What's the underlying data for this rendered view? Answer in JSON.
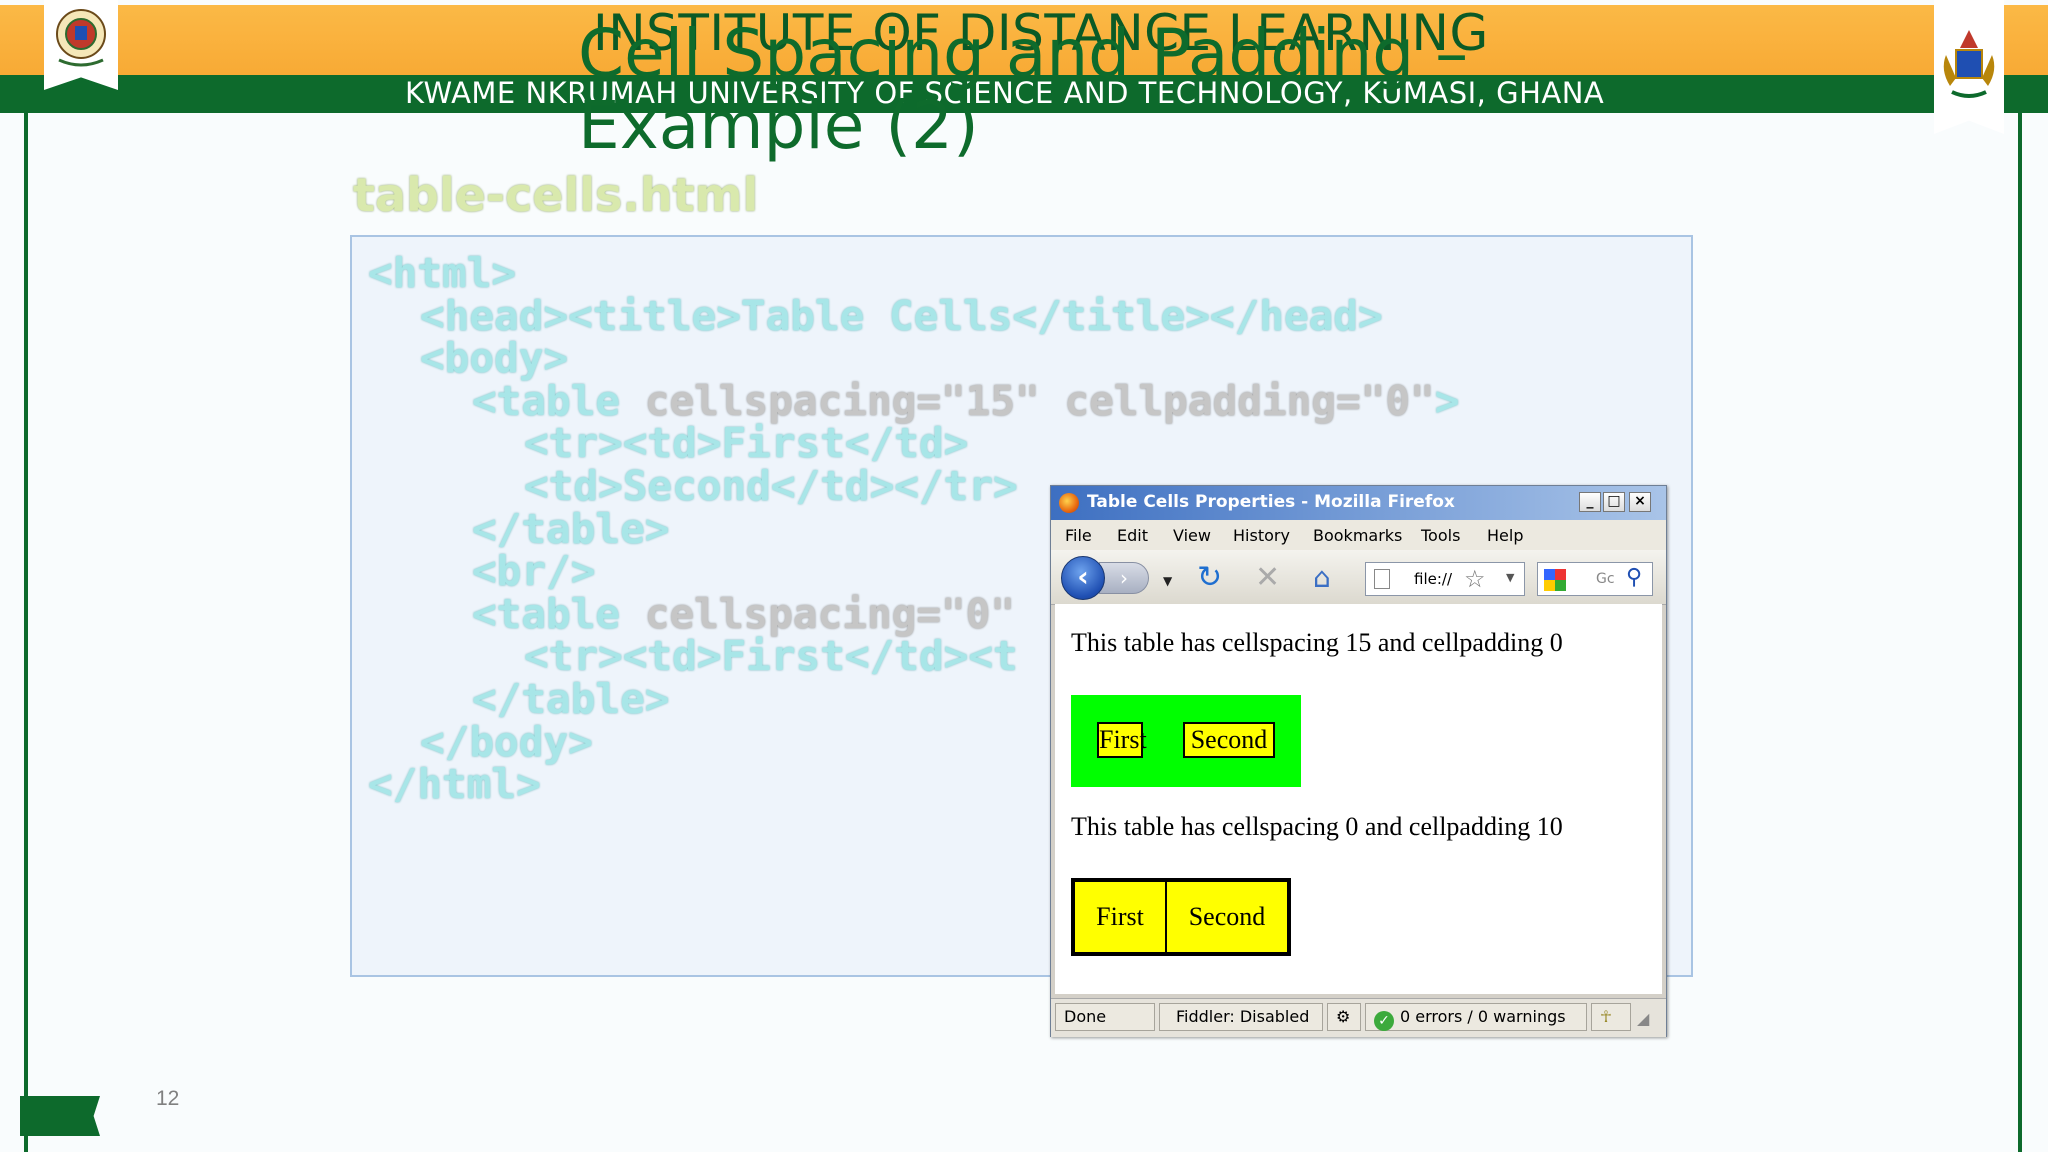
{
  "header": {
    "institute": "INSTITUTE OF DISTANCE LEARNING",
    "university": "KWAME NKRUMAH UNIVERSITY OF SCIENCE AND TECHNOLOGY, KUMASI, GHANA"
  },
  "slide": {
    "title_line1": "Cell Spacing and Padding –",
    "title_line2": "Example (2)",
    "filename": "table-cells.html",
    "page_number": "12"
  },
  "code": {
    "lines": [
      {
        "pre": "<html>",
        "attr": "",
        "post": ""
      },
      {
        "pre": "<head><title>Table Cells</title></head>",
        "attr": "",
        "post": ""
      },
      {
        "pre": "<body>",
        "attr": "",
        "post": ""
      },
      {
        "pre": "<table",
        "attr": " cellspacing=\"15\" cellpadding=\"0\"",
        "post": ">"
      },
      {
        "pre": "<tr><td>First</td>",
        "attr": "",
        "post": ""
      },
      {
        "pre": "<td>Second</td></tr>",
        "attr": "",
        "post": ""
      },
      {
        "pre": "</table>",
        "attr": "",
        "post": ""
      },
      {
        "pre": "<br/>",
        "attr": "",
        "post": ""
      },
      {
        "pre": "<table",
        "attr": " cellspacing=\"0\"",
        "post": ""
      },
      {
        "pre": "<tr><td>First</td><t",
        "attr": "",
        "post": ""
      },
      {
        "pre": "</table>",
        "attr": "",
        "post": ""
      },
      {
        "pre": "</body>",
        "attr": "",
        "post": ""
      },
      {
        "pre": "</html>",
        "attr": "",
        "post": ""
      }
    ]
  },
  "browser": {
    "title": "Table Cells Properties - Mozilla Firefox",
    "menu": [
      "File",
      "Edit",
      "View",
      "History",
      "Bookmarks",
      "Tools",
      "Help"
    ],
    "url": "file://",
    "search_placeholder": "Gc",
    "content": {
      "caption1": "This table has cellspacing 15 and cellpadding 0",
      "table1": [
        "First",
        "Second"
      ],
      "caption2": "This table has cellspacing 0 and cellpadding 10",
      "table2": [
        "First",
        "Second"
      ]
    },
    "status": {
      "state": "Done",
      "fiddler": "Fiddler: Disabled",
      "validator": "0 errors / 0 warnings"
    }
  },
  "colors": {
    "header_yellow": "#f8aa35",
    "header_green": "#0d6a2c",
    "cell_yellow": "#ffff00",
    "table_green": "#00ff00"
  }
}
